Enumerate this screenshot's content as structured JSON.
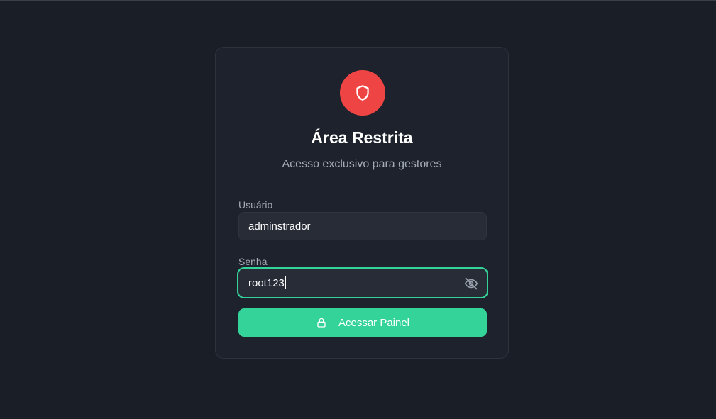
{
  "login": {
    "title": "Área Restrita",
    "subtitle": "Acesso exclusivo para gestores",
    "username_label": "Usuário",
    "username_value": "adminstrador",
    "password_label": "Senha",
    "password_value": "root123",
    "submit_label": "Acessar Painel",
    "icons": {
      "badge": "shield-icon",
      "toggle": "eye-off-icon",
      "submit": "lock-icon"
    }
  },
  "colors": {
    "background": "#1a1e27",
    "card": "#1e222c",
    "badge": "#ef4444",
    "accent": "#34d399"
  }
}
